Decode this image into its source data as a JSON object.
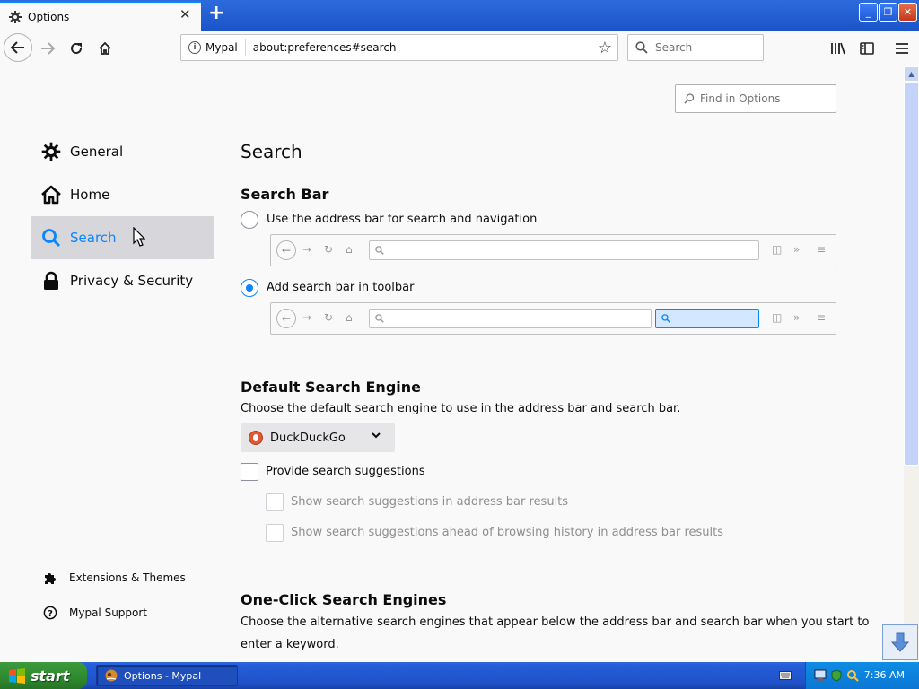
{
  "window": {
    "tab_title": "Options",
    "tab_close": "✕",
    "new_tab": "+",
    "minimize": "_",
    "restore": "❐",
    "close": "✕"
  },
  "navbar": {
    "site_name": "Mypal",
    "url": "about:preferences#search",
    "search_placeholder": "Search"
  },
  "sidebar": {
    "items": [
      {
        "label": "General",
        "icon": "gear-icon"
      },
      {
        "label": "Home",
        "icon": "home-icon"
      },
      {
        "label": "Search",
        "icon": "search-icon"
      },
      {
        "label": "Privacy & Security",
        "icon": "lock-icon"
      }
    ],
    "footer": [
      {
        "label": "Extensions & Themes",
        "icon": "puzzle-icon"
      },
      {
        "label": "Mypal Support",
        "icon": "help-icon"
      }
    ],
    "selected": "Search"
  },
  "main": {
    "find_placeholder": "Find in Options",
    "page_title": "Search",
    "search_bar": {
      "heading": "Search Bar",
      "option_address": "Use the address bar for search and navigation",
      "option_toolbar": "Add search bar in toolbar",
      "selected": "option_toolbar"
    },
    "default_engine": {
      "heading": "Default Search Engine",
      "description": "Choose the default search engine to use in the address bar and search bar.",
      "selected_engine": "DuckDuckGo",
      "provide_suggestions": "Provide search suggestions",
      "show_in_address_bar": "Show search suggestions in address bar results",
      "show_ahead_of_history": "Show search suggestions ahead of browsing history in address bar results"
    },
    "one_click": {
      "heading": "One-Click Search Engines",
      "description_line1": "Choose the alternative search engines that appear below the address bar and search bar when you start to",
      "description_line2": "enter a keyword."
    }
  },
  "taskbar": {
    "start_label": "start",
    "task_label": "Options - Mypal",
    "clock": "7:36 AM"
  },
  "colors": {
    "accent": "#0a84ff",
    "selected_bg": "#d7d7db",
    "taskbar_blue": "#245edb",
    "start_green": "#2e8a2e"
  }
}
